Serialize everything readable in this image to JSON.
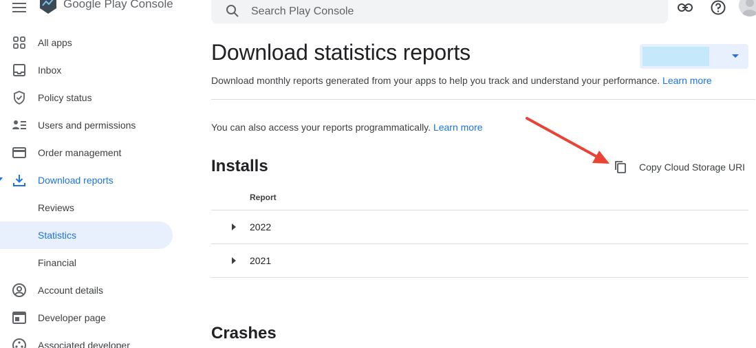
{
  "header": {
    "logo_text": "Google Play Console",
    "search_placeholder": "Search Play Console",
    "icons": [
      "menu-icon",
      "play-console-logo-icon",
      "search-icon",
      "link-icon",
      "help-icon",
      "avatar"
    ]
  },
  "sidebar": {
    "items": [
      {
        "label": "All apps",
        "icon": "grid-icon"
      },
      {
        "label": "Inbox",
        "icon": "inbox-icon"
      },
      {
        "label": "Policy status",
        "icon": "shield-icon"
      },
      {
        "label": "Users and permissions",
        "icon": "users-icon"
      },
      {
        "label": "Order management",
        "icon": "credit-card-icon"
      },
      {
        "label": "Download reports",
        "icon": "download-icon",
        "state": "expanded"
      },
      {
        "label": "Reviews"
      },
      {
        "label": "Statistics",
        "state": "selected"
      },
      {
        "label": "Financial"
      },
      {
        "label": "Account details",
        "icon": "account-circle-icon"
      },
      {
        "label": "Developer page",
        "icon": "web-page-icon"
      },
      {
        "label": "Associated developer",
        "icon": "developer-icon"
      }
    ]
  },
  "main": {
    "title": "Download statistics reports",
    "subtitle": "Download monthly reports generated from your apps to help you track and understand your performance.",
    "subtitle_link": "Learn more",
    "note": "You can also access your reports programmatically.",
    "note_link": "Learn more",
    "installs": {
      "title": "Installs",
      "copy_label": "Copy Cloud Storage URI",
      "column_header": "Report",
      "rows": [
        "2022",
        "2021"
      ]
    },
    "crashes_title": "Crashes"
  },
  "colors": {
    "accent": "#1a73e8",
    "selected_bg": "#e8f0fe",
    "annotation_arrow": "#ea4335"
  }
}
